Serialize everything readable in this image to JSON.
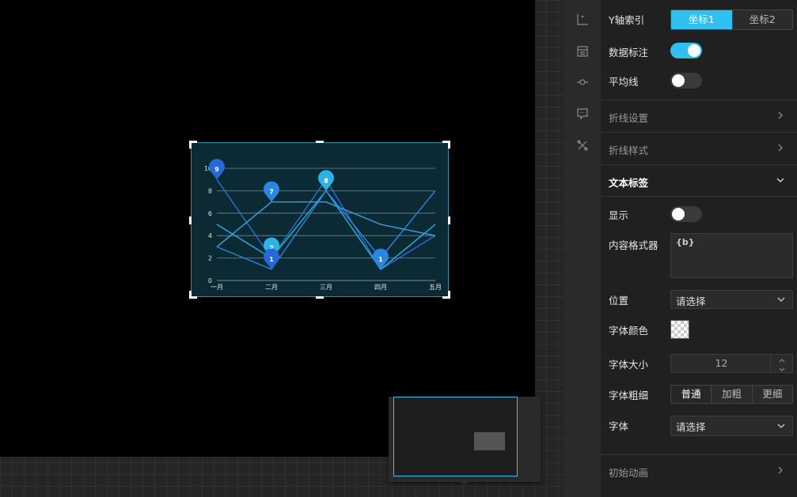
{
  "chart_data": {
    "type": "line",
    "categories": [
      "一月",
      "二月",
      "三月",
      "四月",
      "五月"
    ],
    "y_ticks": [
      "0",
      "2",
      "4",
      "6",
      "8",
      "10"
    ],
    "ylim": [
      0,
      10
    ],
    "grid": true,
    "series": [
      {
        "values": [
          9,
          2,
          9,
          1,
          4
        ],
        "color": "#2e6fd9"
      },
      {
        "values": [
          3,
          7,
          7,
          5,
          4
        ],
        "color": "#3aa3e8"
      },
      {
        "values": [
          5,
          2,
          8,
          1,
          5
        ],
        "color": "#22b5e0"
      },
      {
        "values": [
          3,
          1,
          8,
          2,
          8
        ],
        "color": "#2a86e0"
      }
    ],
    "markers": [
      {
        "x": "一月",
        "y": 9,
        "label": "9",
        "color": "#2569d6"
      },
      {
        "x": "二月",
        "y": 7,
        "label": "7",
        "color": "#2a86e0"
      },
      {
        "x": "二月",
        "y": 2,
        "label": "2",
        "color": "#2bb3e6"
      },
      {
        "x": "二月",
        "y": 1,
        "label": "1",
        "color": "#2569d6"
      },
      {
        "x": "三月",
        "y": 8,
        "label": "8",
        "color": "#2bb3e6"
      },
      {
        "x": "四月",
        "y": 1,
        "label": "1",
        "color": "#2a86e0"
      }
    ]
  },
  "panel": {
    "y_axis_index": {
      "label": "Y轴索引",
      "options": [
        "坐标1",
        "坐标2"
      ],
      "selected": "坐标1"
    },
    "data_label": {
      "label": "数据标注",
      "on": true
    },
    "avg_line": {
      "label": "平均线",
      "on": false
    },
    "sections": {
      "line_settings": "折线设置",
      "line_style": "折线样式",
      "text_label": "文本标签",
      "init_anim": "初始动画"
    },
    "show": {
      "label": "显示",
      "on": false
    },
    "formatter": {
      "label": "内容格式器",
      "value": "{b}"
    },
    "position": {
      "label": "位置",
      "value": "请选择"
    },
    "font_color": {
      "label": "字体颜色"
    },
    "font_size": {
      "label": "字体大小",
      "value": "12"
    },
    "font_weight": {
      "label": "字体粗细",
      "options": [
        "普通",
        "加粗",
        "更细"
      ],
      "selected": "普通"
    },
    "font_family": {
      "label": "字体",
      "value": "请选择"
    }
  },
  "icons": [
    "axis-icon",
    "data-table-icon",
    "line-point-icon",
    "tooltip-icon",
    "tools-icon"
  ]
}
